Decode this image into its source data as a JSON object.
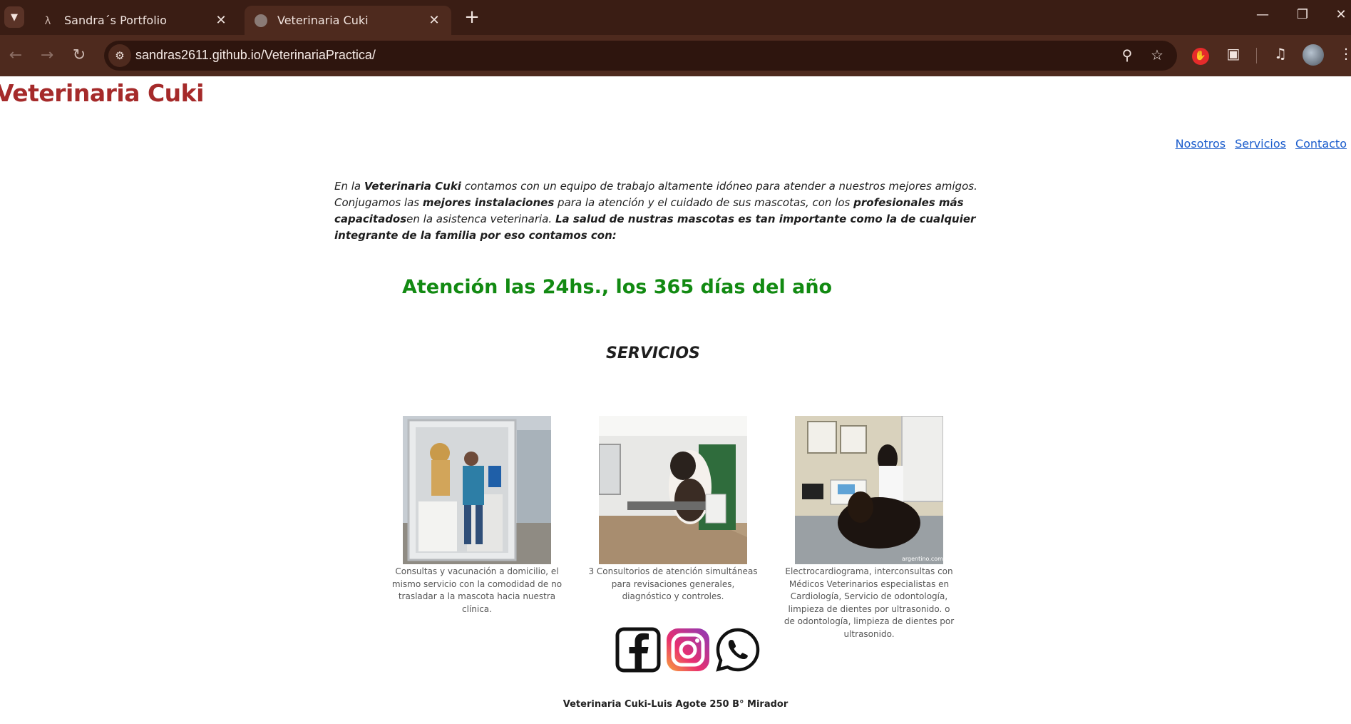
{
  "browser": {
    "tabs": [
      {
        "title": "Sandra´s Portfolio",
        "active": false,
        "favicon": "lambda-icon"
      },
      {
        "title": "Veterinaria Cuki",
        "active": true,
        "favicon": "globe-icon"
      }
    ],
    "url": "sandras2611.github.io/VeterinariaPractica/"
  },
  "site": {
    "title": "Veterinaria Cuki",
    "nav": [
      "Nosotros",
      "Servicios",
      "Contacto"
    ]
  },
  "intro": {
    "p1": "En la ",
    "b1": "Veterinaria Cuki",
    "p2": " contamos con un equipo de trabajo altamente idóneo para atender a nuestros mejores amigos. Conjugamos las ",
    "b2": "mejores instalaciones",
    "p3": " para la atención y el cuidado de sus mascotas, con los ",
    "b3": "profesionales más capacitados",
    "p4": "en la asistenca veterinaria. ",
    "b4": "La salud de nustras mascotas es tan importante como la de cualquier integrante de la familia por eso contamos con:"
  },
  "highlight": "Atención las 24hs., los 365 días del año",
  "services": {
    "title": "SERVICIOS",
    "items": [
      {
        "caption": "Consultas y vacunación a domicilio, el mismo servicio con la comodidad de no trasladar a la mascota hacia nuestra clínica."
      },
      {
        "caption": "3 Consultorios de atención simultáneas para revisaciones generales, diagnóstico y controles."
      },
      {
        "caption": "Electrocardiograma, interconsultas con Médicos Veterinarios especialistas en Cardiología, Servicio de odontología, limpieza de dientes por ultrasonido. o de odontología, limpieza de dientes por ultrasonido.",
        "watermark": "argentino.com.ar"
      }
    ]
  },
  "social": [
    "facebook-icon",
    "instagram-icon",
    "whatsapp-icon"
  ],
  "footer": "Veterinaria Cuki-Luis Agote 250 B° Mirador",
  "colors": {
    "title": "#a52a2a",
    "highlight": "#128a12",
    "link": "#1a5ccc",
    "chrome_dark": "#3a1d14",
    "chrome_toolbar": "#4e2a1e"
  }
}
